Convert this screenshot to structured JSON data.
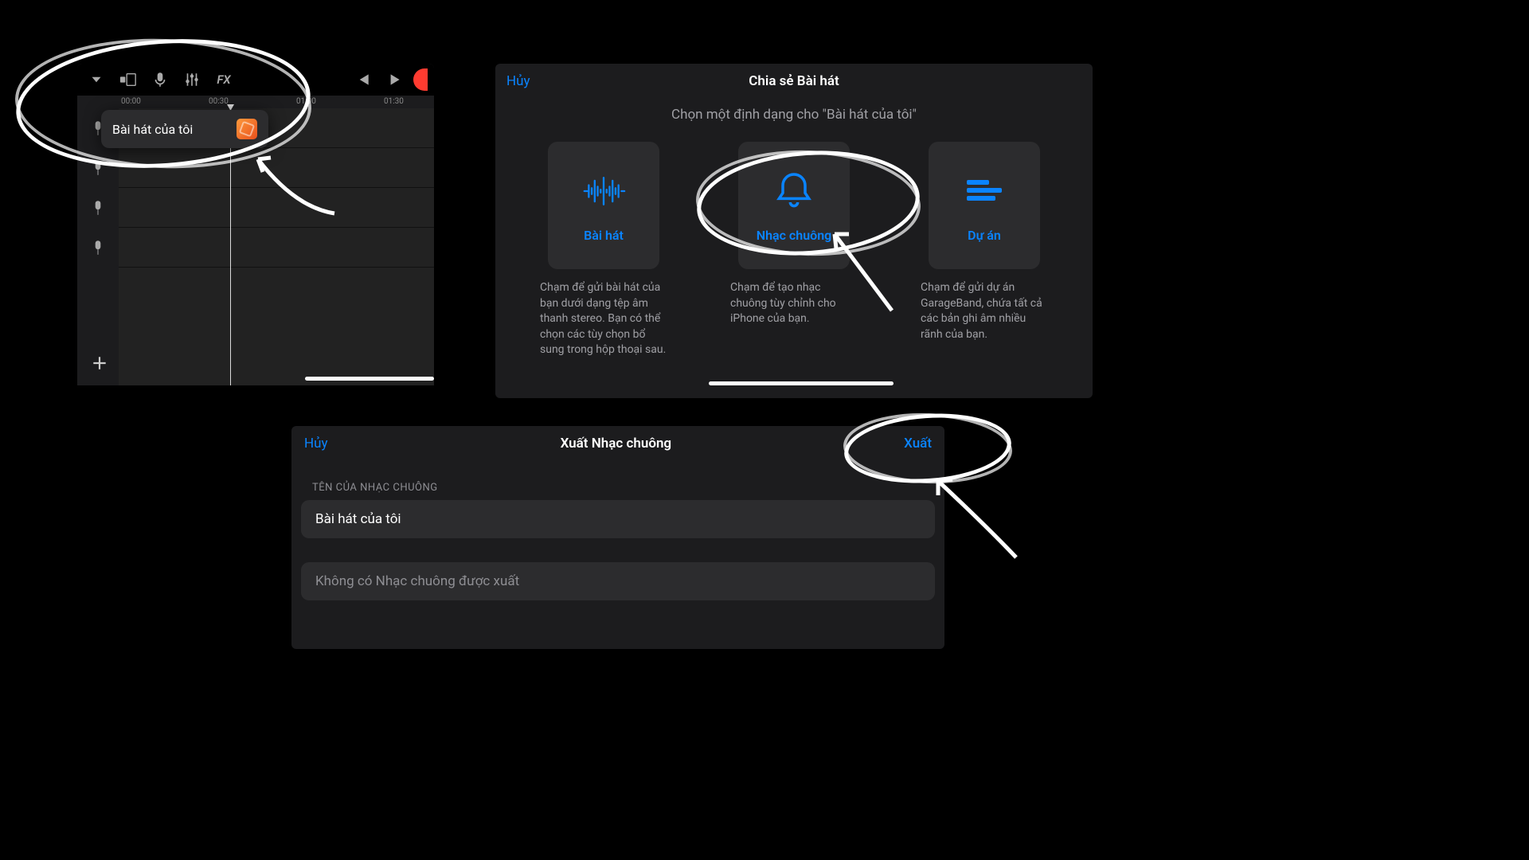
{
  "panel1": {
    "popup_label": "Bài hát của tôi",
    "ruler": [
      "00:00",
      "00:30",
      "01:00",
      "01:30"
    ]
  },
  "panel2": {
    "cancel": "Hủy",
    "title": "Chia sẻ Bài hát",
    "subtitle": "Chọn một định dạng cho \"Bài hát của tôi\"",
    "cards": [
      {
        "label": "Bài hát",
        "desc": "Chạm để gửi bài hát của bạn dưới dạng tệp âm thanh stereo. Bạn có thể chọn các tùy chọn bổ sung trong hộp thoại sau."
      },
      {
        "label": "Nhạc chuông",
        "desc": "Chạm để tạo nhạc chuông tùy chỉnh cho iPhone của bạn."
      },
      {
        "label": "Dự án",
        "desc": "Chạm để gửi dự án GarageBand, chứa tất cả các bản ghi âm nhiều rãnh của bạn."
      }
    ]
  },
  "panel3": {
    "cancel": "Hủy",
    "title": "Xuất Nhạc chuông",
    "export": "Xuất",
    "field_label": "TÊN CỦA NHẠC CHUÔNG",
    "field_value": "Bài hát của tôi",
    "readonly": "Không có Nhạc chuông được xuất"
  }
}
